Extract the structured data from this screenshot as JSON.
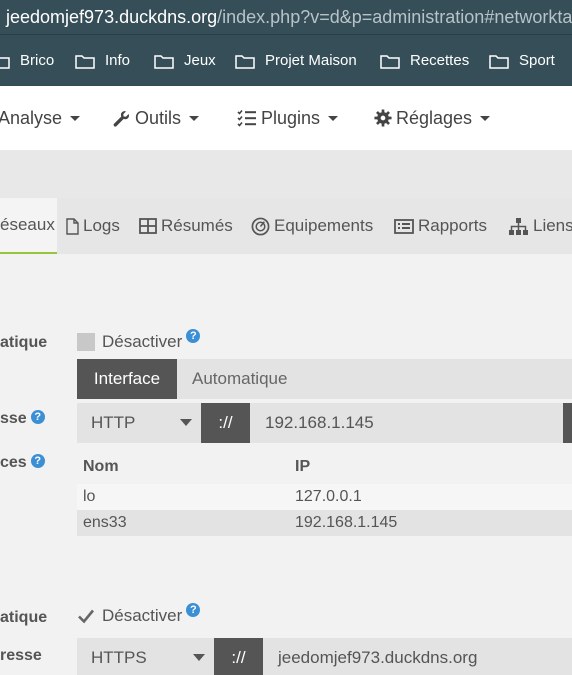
{
  "browser": {
    "url_host": "jeedomjef973.duckdns.org",
    "url_path": "/index.php?v=d&p=administration#networktab"
  },
  "bookmarks": [
    {
      "label": "Brico",
      "icon": "folder-icon"
    },
    {
      "label": "Info",
      "icon": "folder-icon"
    },
    {
      "label": "Jeux",
      "icon": "folder-icon"
    },
    {
      "label": "Projet Maison",
      "icon": "folder-icon"
    },
    {
      "label": "Recettes",
      "icon": "folder-icon"
    },
    {
      "label": "Sport",
      "icon": "folder-icon"
    }
  ],
  "nav": {
    "analyse": "Analyse",
    "outils": "Outils",
    "plugins": "Plugins",
    "reglages": "Réglages"
  },
  "tabs": {
    "reseaux": "éseaux",
    "logs": "Logs",
    "resumes": "Résumés",
    "equipements": "Equipements",
    "rapports": "Rapports",
    "liens": "Liens"
  },
  "internal": {
    "auto_label": "atique",
    "disable_label": "Désactiver",
    "mode_active": "Interface",
    "mode_inactive": "Automatique",
    "address_label": "sse",
    "protocol": "HTTP",
    "separator": "://",
    "address_value": "192.168.1.145",
    "interfaces_label": "ces",
    "table": {
      "headers": [
        "Nom",
        "IP"
      ],
      "rows": [
        [
          "lo",
          "127.0.0.1"
        ],
        [
          "ens33",
          "192.168.1.145"
        ]
      ]
    }
  },
  "external": {
    "auto_label": "atique",
    "disable_label": "Désactiver",
    "address_label": "resse",
    "protocol": "HTTPS",
    "separator": "://",
    "address_value": "jeedomjef973.duckdns.org"
  },
  "help_glyph": "?",
  "colors": {
    "browser_bar": "#364e58",
    "active_tab_underline": "#94c53d",
    "help_icon": "#3b8fd4",
    "dark_button": "#555555"
  }
}
